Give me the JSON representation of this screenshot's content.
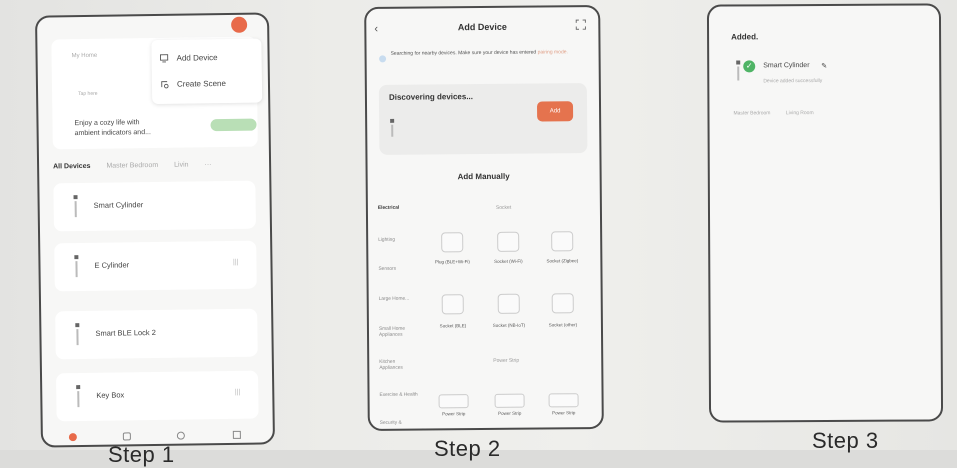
{
  "captions": {
    "step1": "Step 1",
    "step2": "Step 2",
    "step3": "Step 3"
  },
  "step1": {
    "home_name": "My Home",
    "small_label": "Tap here",
    "promo_text": "Enjoy a cozy life with ambient indicators and...",
    "menu": {
      "add_device": "Add Device",
      "create_scene": "Create Scene"
    },
    "tabs": [
      "All Devices",
      "Master Bedroom",
      "Livin"
    ],
    "tabs_more": "···",
    "devices": [
      {
        "name": "Smart Cylinder",
        "meta": ""
      },
      {
        "name": "E Cylinder",
        "meta": "|||"
      },
      {
        "name": "Smart BLE Lock 2",
        "meta": ""
      },
      {
        "name": "Key Box",
        "meta": "|||"
      }
    ]
  },
  "step2": {
    "title": "Add Device",
    "search_text": "Searching for nearby devices. Make sure your device has entered",
    "search_link": "pairing mode.",
    "discovering": "Discovering devices...",
    "add_button": "Add",
    "manual_title": "Add Manually",
    "categories": [
      "Electrical",
      "Lighting",
      "Sensors",
      "Large Home...",
      "Small Home Appliances",
      "Kitchen Appliances",
      "Exercise & Health",
      "Security &"
    ],
    "section_socket": "Socket",
    "section_power_strip": "Power Strip",
    "tiles": [
      {
        "label": ""
      },
      {
        "label": ""
      },
      {
        "label": ""
      },
      {
        "label": "Plug (BLE+Wi-Fi)"
      },
      {
        "label": "Socket (Wi-Fi)"
      },
      {
        "label": "Socket (Zigbee)"
      },
      {
        "label": ""
      },
      {
        "label": ""
      },
      {
        "label": ""
      },
      {
        "label": "Socket (BLE)"
      },
      {
        "label": "Socket (NB-IoT)"
      },
      {
        "label": "Socket (other)"
      }
    ],
    "strips": [
      {
        "label": "Power Strip"
      },
      {
        "label": "Power Strip"
      },
      {
        "label": "Power Strip"
      }
    ]
  },
  "step3": {
    "added_label": "Added.",
    "device_name": "Smart Cylinder",
    "device_sub": "Device added successfully",
    "rooms": [
      "Master Bedroom",
      "Living Room"
    ]
  }
}
